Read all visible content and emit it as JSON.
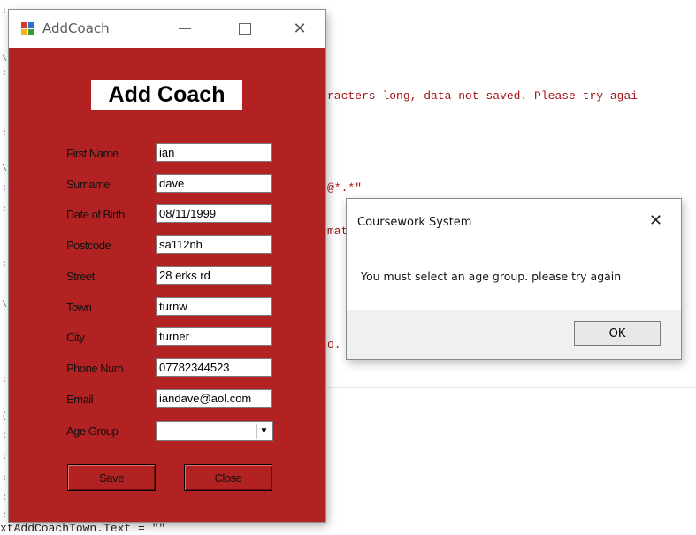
{
  "editor": {
    "line_msg1": "racters long, data not saved. Please try agai",
    "line_regex": "@*.*\"",
    "line_mat": "mat",
    "line_o": "o.",
    "line_bottom": "xtAddCoachTown.Text = \"\""
  },
  "addcoach": {
    "window_title": "AddCoach",
    "form_title": "Add Coach",
    "fields": [
      {
        "label": "First Name",
        "value": "ian"
      },
      {
        "label": "Surname",
        "value": "dave"
      },
      {
        "label": "Date of Birth",
        "value": "08/11/1999"
      },
      {
        "label": "Postcode",
        "value": "sa112nh"
      },
      {
        "label": "Street",
        "value": "28 erks rd"
      },
      {
        "label": "Town",
        "value": "turnw"
      },
      {
        "label": "City",
        "value": "turner"
      },
      {
        "label": "Phone Num",
        "value": "07782344523"
      },
      {
        "label": "Email",
        "value": "iandave@aol.com"
      }
    ],
    "age_group_label": "Age Group",
    "age_group_value": "",
    "save_label": "Save",
    "close_label": "Close",
    "background_color": "#b22222"
  },
  "msgbox": {
    "title": "Coursework System",
    "message": "You must select an age group. please try again",
    "ok_label": "OK"
  }
}
